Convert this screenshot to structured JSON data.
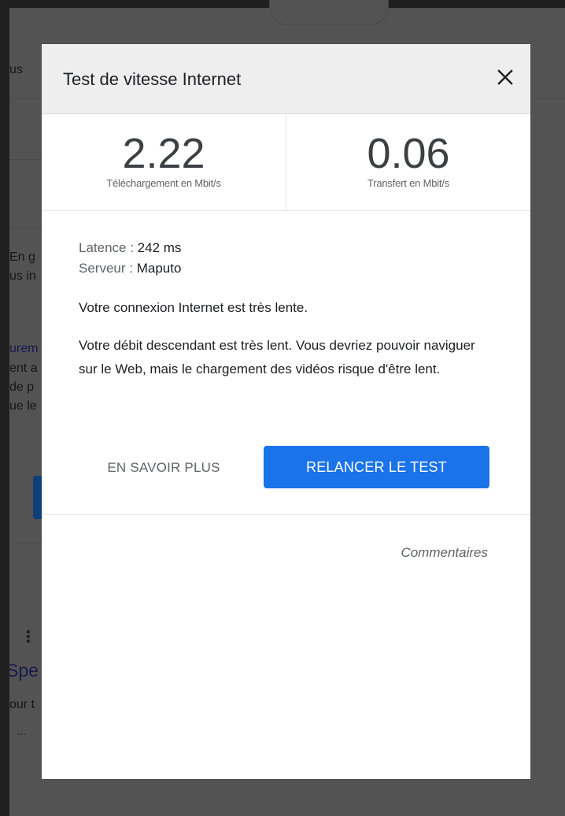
{
  "background": {
    "tab_fragment": "us",
    "text_fragments": [
      "En g",
      "us in",
      "urem",
      "ent a",
      "de p",
      "ue le",
      "our t",
      "..."
    ],
    "title_fragment": "Spe"
  },
  "dialog": {
    "title": "Test de vitesse Internet",
    "close_icon": "close-icon",
    "download": {
      "value": "2.22",
      "label": "Téléchargement en Mbit/s"
    },
    "upload": {
      "value": "0.06",
      "label": "Transfert en Mbit/s"
    },
    "latency": {
      "label": "Latence : ",
      "value": "242 ms"
    },
    "server": {
      "label": "Serveur : ",
      "value": "Maputo"
    },
    "summary": "Votre connexion Internet est très lente.",
    "description": "Votre débit descendant est très lent. Vous devriez pouvoir naviguer sur le Web, mais le chargement des vidéos risque d'être lent.",
    "learn_more": "EN SAVOIR PLUS",
    "retest": "RELANCER LE TEST",
    "feedback": "Commentaires"
  },
  "colors": {
    "accent": "#1a73e8",
    "overlay": "#535353",
    "header_bg": "#eeeeee"
  }
}
